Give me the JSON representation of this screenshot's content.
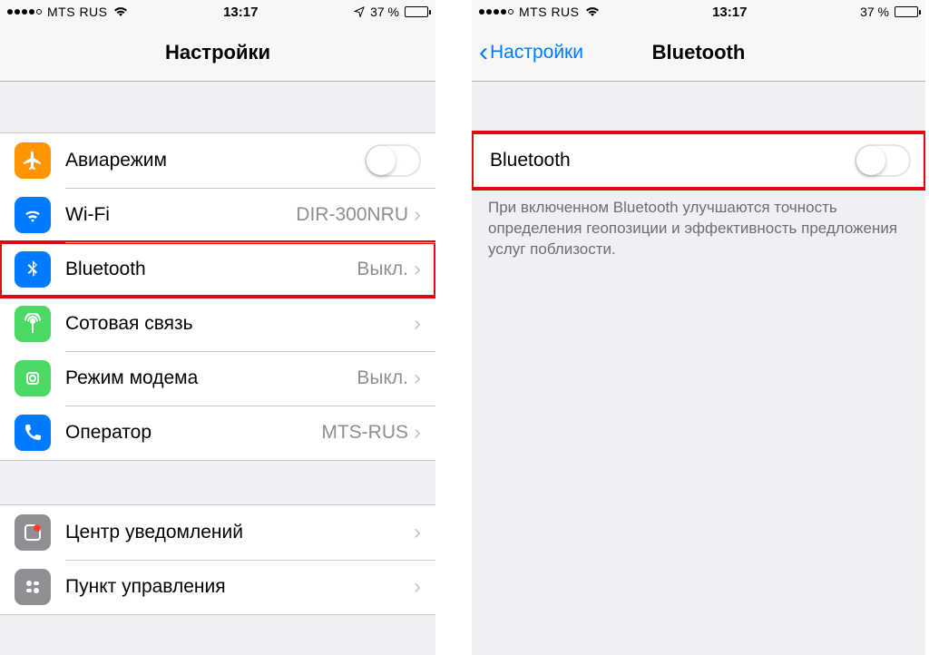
{
  "left": {
    "status": {
      "carrier": "MTS RUS",
      "time": "13:17",
      "battery_pct": "37 %",
      "show_location": true
    },
    "nav": {
      "title": "Настройки"
    },
    "group1": [
      {
        "icon": "airplane",
        "label": "Авиарежим",
        "type": "toggle",
        "on": false
      },
      {
        "icon": "wifi",
        "label": "Wi-Fi",
        "type": "link",
        "value": "DIR-300NRU"
      },
      {
        "icon": "bt",
        "label": "Bluetooth",
        "type": "link",
        "value": "Выкл.",
        "highlight": true
      },
      {
        "icon": "cell",
        "label": "Сотовая связь",
        "type": "link",
        "value": ""
      },
      {
        "icon": "hotspot",
        "label": "Режим модема",
        "type": "link",
        "value": "Выкл."
      },
      {
        "icon": "carrier",
        "label": "Оператор",
        "type": "link",
        "value": "MTS-RUS"
      }
    ],
    "group2": [
      {
        "icon": "notif",
        "label": "Центр уведомлений",
        "type": "link"
      },
      {
        "icon": "control",
        "label": "Пункт управления",
        "type": "link"
      }
    ]
  },
  "right": {
    "status": {
      "carrier": "MTS RUS",
      "time": "13:17",
      "battery_pct": "37 %",
      "show_location": false
    },
    "nav": {
      "back": "Настройки",
      "title": "Bluetooth"
    },
    "row": {
      "label": "Bluetooth",
      "on": false,
      "highlight": true
    },
    "note": "При включенном Bluetooth улучшаются точность определения геопозиции и эффективность предложения услуг поблизости."
  }
}
